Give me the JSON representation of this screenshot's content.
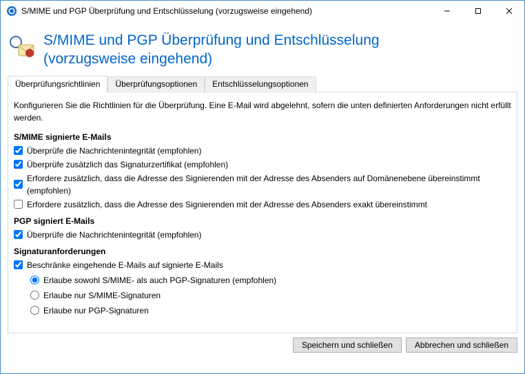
{
  "window": {
    "title": "S/MIME und PGP Überprüfung und Entschlüsselung (vorzugsweise eingehend)"
  },
  "header": {
    "line1": "S/MIME und PGP Überprüfung und Entschlüsselung",
    "line2": "(vorzugsweise eingehend)"
  },
  "tabs": {
    "t0": "Überprüfungsrichtlinien",
    "t1": "Überprüfungsoptionen",
    "t2": "Entschlüsselungsoptionen"
  },
  "panel": {
    "description": "Konfigurieren Sie die Richtlinien für die Überprüfung. Eine E-Mail wird abgelehnt, sofern die unten definierten Anforderungen nicht erfüllt werden.",
    "smime_title": "S/MIME signierte E-Mails",
    "smime_c1": "Überprüfe die Nachrichtenintegrität (empfohlen)",
    "smime_c2": "Überprüfe zusätzlich das Signaturzertifikat (empfohlen)",
    "smime_c3": "Erfordere zusätzlich, dass die Adresse des Signierenden mit der Adresse des Absenders auf Domänenebene übereinstimmt (empfohlen)",
    "smime_c4": "Erfordere zusätzlich, dass die Adresse des Signierenden mit der Adresse des Absenders exakt übereinstimmt",
    "pgp_title": "PGP signiert E-Mails",
    "pgp_c1": "Überprüfe die Nachrichtenintegrität (empfohlen)",
    "sig_title": "Signaturanforderungen",
    "sig_c1": "Beschränke eingehende E-Mails auf signierte E-Mails",
    "sig_r1": "Erlaube sowohl S/MIME- als auch PGP-Signaturen (empfohlen)",
    "sig_r2": "Erlaube nur S/MIME-Signaturen",
    "sig_r3": "Erlaube nur PGP-Signaturen"
  },
  "footer": {
    "save": "Speichern und schließen",
    "cancel": "Abbrechen und schließen"
  },
  "state": {
    "smime_c1": true,
    "smime_c2": true,
    "smime_c3": true,
    "smime_c4": false,
    "pgp_c1": true,
    "sig_c1": true,
    "sig_radio": "r1"
  }
}
